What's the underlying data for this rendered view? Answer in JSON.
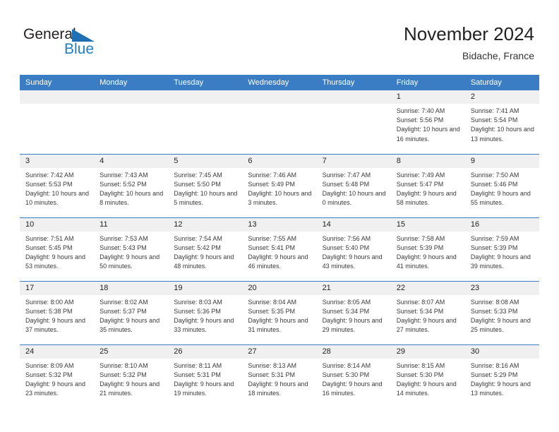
{
  "brand": {
    "word_one": "General",
    "word_two": "Blue",
    "triangle_icon": "brand-triangle-icon",
    "accent_color": "#1f7ec4"
  },
  "header": {
    "title": "November 2024",
    "subtitle": "Bidache, France"
  },
  "theme": {
    "header_blue": "#3a7dc4",
    "daynum_band": "#f0f0f0",
    "text": "#3a3a3a"
  },
  "calendar": {
    "weekday_headers": [
      "Sunday",
      "Monday",
      "Tuesday",
      "Wednesday",
      "Thursday",
      "Friday",
      "Saturday"
    ],
    "weeks": [
      [
        {
          "day": "",
          "blank": true
        },
        {
          "day": "",
          "blank": true
        },
        {
          "day": "",
          "blank": true
        },
        {
          "day": "",
          "blank": true
        },
        {
          "day": "",
          "blank": true
        },
        {
          "day": "1",
          "sunrise": "Sunrise: 7:40 AM",
          "sunset": "Sunset: 5:56 PM",
          "daylight": "Daylight: 10 hours and 16 minutes."
        },
        {
          "day": "2",
          "sunrise": "Sunrise: 7:41 AM",
          "sunset": "Sunset: 5:54 PM",
          "daylight": "Daylight: 10 hours and 13 minutes."
        }
      ],
      [
        {
          "day": "3",
          "sunrise": "Sunrise: 7:42 AM",
          "sunset": "Sunset: 5:53 PM",
          "daylight": "Daylight: 10 hours and 10 minutes."
        },
        {
          "day": "4",
          "sunrise": "Sunrise: 7:43 AM",
          "sunset": "Sunset: 5:52 PM",
          "daylight": "Daylight: 10 hours and 8 minutes."
        },
        {
          "day": "5",
          "sunrise": "Sunrise: 7:45 AM",
          "sunset": "Sunset: 5:50 PM",
          "daylight": "Daylight: 10 hours and 5 minutes."
        },
        {
          "day": "6",
          "sunrise": "Sunrise: 7:46 AM",
          "sunset": "Sunset: 5:49 PM",
          "daylight": "Daylight: 10 hours and 3 minutes."
        },
        {
          "day": "7",
          "sunrise": "Sunrise: 7:47 AM",
          "sunset": "Sunset: 5:48 PM",
          "daylight": "Daylight: 10 hours and 0 minutes."
        },
        {
          "day": "8",
          "sunrise": "Sunrise: 7:49 AM",
          "sunset": "Sunset: 5:47 PM",
          "daylight": "Daylight: 9 hours and 58 minutes."
        },
        {
          "day": "9",
          "sunrise": "Sunrise: 7:50 AM",
          "sunset": "Sunset: 5:46 PM",
          "daylight": "Daylight: 9 hours and 55 minutes."
        }
      ],
      [
        {
          "day": "10",
          "sunrise": "Sunrise: 7:51 AM",
          "sunset": "Sunset: 5:45 PM",
          "daylight": "Daylight: 9 hours and 53 minutes."
        },
        {
          "day": "11",
          "sunrise": "Sunrise: 7:53 AM",
          "sunset": "Sunset: 5:43 PM",
          "daylight": "Daylight: 9 hours and 50 minutes."
        },
        {
          "day": "12",
          "sunrise": "Sunrise: 7:54 AM",
          "sunset": "Sunset: 5:42 PM",
          "daylight": "Daylight: 9 hours and 48 minutes."
        },
        {
          "day": "13",
          "sunrise": "Sunrise: 7:55 AM",
          "sunset": "Sunset: 5:41 PM",
          "daylight": "Daylight: 9 hours and 46 minutes."
        },
        {
          "day": "14",
          "sunrise": "Sunrise: 7:56 AM",
          "sunset": "Sunset: 5:40 PM",
          "daylight": "Daylight: 9 hours and 43 minutes."
        },
        {
          "day": "15",
          "sunrise": "Sunrise: 7:58 AM",
          "sunset": "Sunset: 5:39 PM",
          "daylight": "Daylight: 9 hours and 41 minutes."
        },
        {
          "day": "16",
          "sunrise": "Sunrise: 7:59 AM",
          "sunset": "Sunset: 5:39 PM",
          "daylight": "Daylight: 9 hours and 39 minutes."
        }
      ],
      [
        {
          "day": "17",
          "sunrise": "Sunrise: 8:00 AM",
          "sunset": "Sunset: 5:38 PM",
          "daylight": "Daylight: 9 hours and 37 minutes."
        },
        {
          "day": "18",
          "sunrise": "Sunrise: 8:02 AM",
          "sunset": "Sunset: 5:37 PM",
          "daylight": "Daylight: 9 hours and 35 minutes."
        },
        {
          "day": "19",
          "sunrise": "Sunrise: 8:03 AM",
          "sunset": "Sunset: 5:36 PM",
          "daylight": "Daylight: 9 hours and 33 minutes."
        },
        {
          "day": "20",
          "sunrise": "Sunrise: 8:04 AM",
          "sunset": "Sunset: 5:35 PM",
          "daylight": "Daylight: 9 hours and 31 minutes."
        },
        {
          "day": "21",
          "sunrise": "Sunrise: 8:05 AM",
          "sunset": "Sunset: 5:34 PM",
          "daylight": "Daylight: 9 hours and 29 minutes."
        },
        {
          "day": "22",
          "sunrise": "Sunrise: 8:07 AM",
          "sunset": "Sunset: 5:34 PM",
          "daylight": "Daylight: 9 hours and 27 minutes."
        },
        {
          "day": "23",
          "sunrise": "Sunrise: 8:08 AM",
          "sunset": "Sunset: 5:33 PM",
          "daylight": "Daylight: 9 hours and 25 minutes."
        }
      ],
      [
        {
          "day": "24",
          "sunrise": "Sunrise: 8:09 AM",
          "sunset": "Sunset: 5:32 PM",
          "daylight": "Daylight: 9 hours and 23 minutes."
        },
        {
          "day": "25",
          "sunrise": "Sunrise: 8:10 AM",
          "sunset": "Sunset: 5:32 PM",
          "daylight": "Daylight: 9 hours and 21 minutes."
        },
        {
          "day": "26",
          "sunrise": "Sunrise: 8:11 AM",
          "sunset": "Sunset: 5:31 PM",
          "daylight": "Daylight: 9 hours and 19 minutes."
        },
        {
          "day": "27",
          "sunrise": "Sunrise: 8:13 AM",
          "sunset": "Sunset: 5:31 PM",
          "daylight": "Daylight: 9 hours and 18 minutes."
        },
        {
          "day": "28",
          "sunrise": "Sunrise: 8:14 AM",
          "sunset": "Sunset: 5:30 PM",
          "daylight": "Daylight: 9 hours and 16 minutes."
        },
        {
          "day": "29",
          "sunrise": "Sunrise: 8:15 AM",
          "sunset": "Sunset: 5:30 PM",
          "daylight": "Daylight: 9 hours and 14 minutes."
        },
        {
          "day": "30",
          "sunrise": "Sunrise: 8:16 AM",
          "sunset": "Sunset: 5:29 PM",
          "daylight": "Daylight: 9 hours and 13 minutes."
        }
      ]
    ]
  }
}
